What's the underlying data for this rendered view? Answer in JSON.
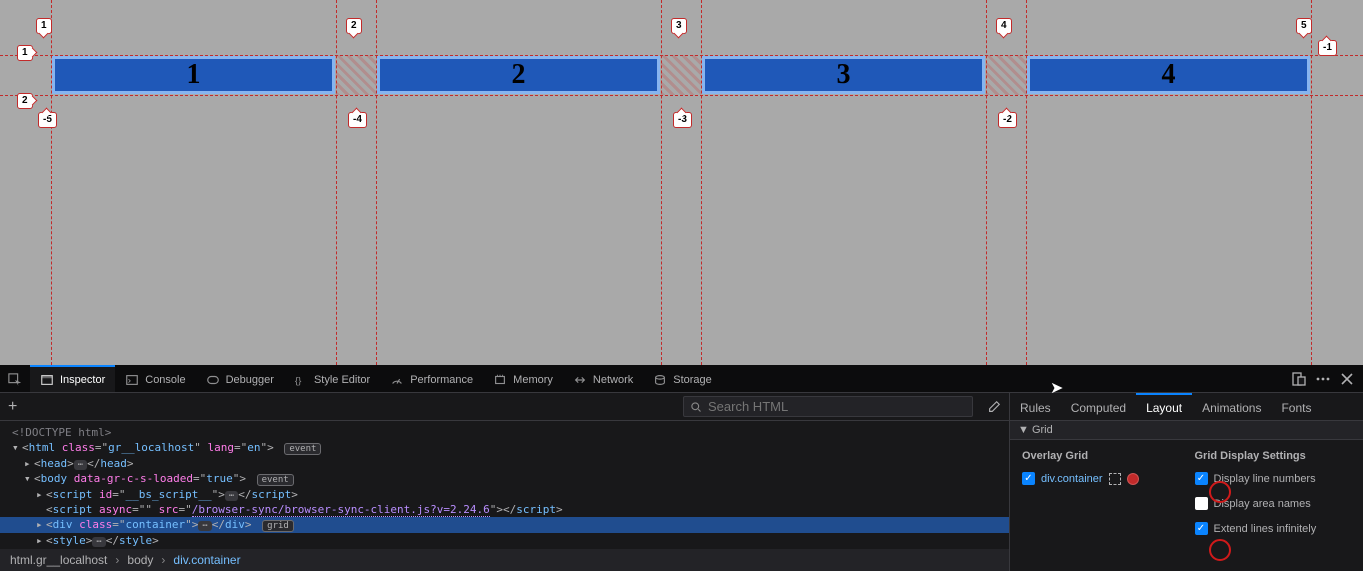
{
  "viewport": {
    "boxes": [
      "1",
      "2",
      "3",
      "4"
    ],
    "col_lines": {
      "pos": [
        "1",
        "2",
        "3",
        "4",
        "5"
      ],
      "neg": [
        "-5",
        "-4",
        "-3",
        "-2",
        "-1"
      ]
    },
    "row_lines": {
      "pos": [
        "1",
        "2"
      ]
    }
  },
  "toolbox": {
    "tabs": {
      "inspector": "Inspector",
      "console": "Console",
      "debugger": "Debugger",
      "style_editor": "Style Editor",
      "performance": "Performance",
      "memory": "Memory",
      "network": "Network",
      "storage": "Storage"
    }
  },
  "markup": {
    "search_placeholder": "Search HTML",
    "lines": {
      "doctype": "<!DOCTYPE html>",
      "html_tag": "html",
      "html_class_attr": "class",
      "html_class_val": "gr__localhost",
      "html_lang_attr": "lang",
      "html_lang_val": "en",
      "badge_event": "event",
      "head_open": "head",
      "body_tag": "body",
      "body_attr": "data-gr-c-s-loaded",
      "body_val": "true",
      "script1_id_attr": "id",
      "script1_id_val": "__bs_script__",
      "script_tag": "script",
      "script2_async_attr": "async",
      "script2_src_attr": "src",
      "script2_src_val": "/browser-sync/browser-sync-client.js?v=2.24.6",
      "div_tag": "div",
      "div_class_attr": "class",
      "div_class_val": "container",
      "badge_grid": "grid",
      "style_tag": "style"
    },
    "breadcrumb": {
      "html": "html.gr__localhost",
      "body": "body",
      "div": "div.container"
    }
  },
  "sidebar": {
    "tabs": {
      "rules": "Rules",
      "computed": "Computed",
      "layout": "Layout",
      "animations": "Animations",
      "fonts": "Fonts"
    },
    "grid_header": "Grid",
    "overlay_hdr": "Overlay Grid",
    "settings_hdr": "Grid Display Settings",
    "container_label": "div.container",
    "opt_line_numbers": "Display line numbers",
    "opt_area_names": "Display area names",
    "opt_extend": "Extend lines infinitely"
  }
}
